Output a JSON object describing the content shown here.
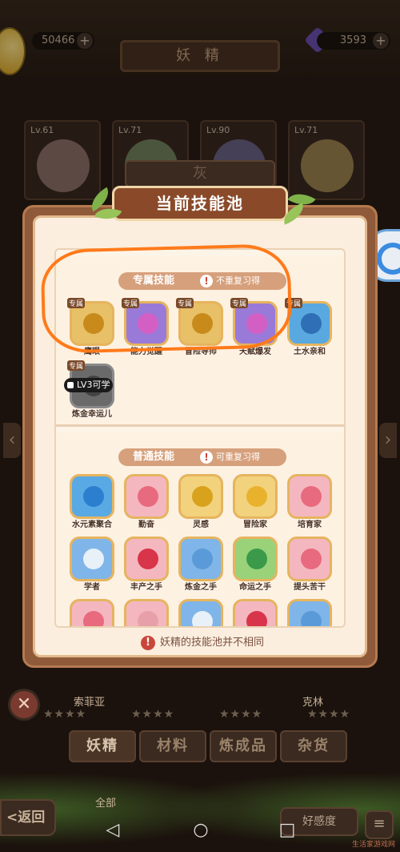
{
  "top_bar": {
    "title": "妖 精",
    "coins": "50466",
    "gems": "3593",
    "plus": "+"
  },
  "bg_cards": [
    {
      "level": "Lv.61"
    },
    {
      "level": "Lv.71"
    },
    {
      "level": "Lv.90"
    },
    {
      "level": "Lv.71"
    }
  ],
  "popup": {
    "back_tab": "灰",
    "title": "当前技能池",
    "exclusive_section": {
      "name": "专属技能",
      "warn": "!",
      "note": "不重复习得",
      "skills": [
        {
          "tag": "专属",
          "label": "鹰眼",
          "color": "#e7c067",
          "emblem": "#c98a1c"
        },
        {
          "tag": "专属",
          "label": "能力觉醒",
          "color": "#9a7ad8",
          "emblem": "#d35fc4"
        },
        {
          "tag": "专属",
          "label": "冒险导师",
          "color": "#e7c067",
          "emblem": "#c98a1c"
        },
        {
          "tag": "专属",
          "label": "天赋爆发",
          "color": "#9a7ad8",
          "emblem": "#d35fc4"
        },
        {
          "tag": "专属",
          "label": "土水亲和",
          "color": "#5aa8e0",
          "emblem": "#2f6fb5"
        },
        {
          "tag": "专属",
          "label": "炼金幸运儿",
          "color": "#6a6a6a",
          "emblem": "#444444",
          "locked": "LV3可学"
        }
      ]
    },
    "normal_section": {
      "name": "普通技能",
      "warn": "!",
      "note": "可重复习得",
      "skills": [
        {
          "label": "水元素聚合",
          "color": "#59a9e4",
          "emblem": "#2c7fcf"
        },
        {
          "label": "勤奋",
          "color": "#f4b7c0",
          "emblem": "#e86a7e"
        },
        {
          "label": "灵感",
          "color": "#f2d27c",
          "emblem": "#d9a21c"
        },
        {
          "label": "冒险家",
          "color": "#f2d27c",
          "emblem": "#e8b22c"
        },
        {
          "label": "培育家",
          "color": "#f4b7c0",
          "emblem": "#e86a7e"
        },
        {
          "label": "学者",
          "color": "#7fb5e8",
          "emblem": "#e8f0f8"
        },
        {
          "label": "丰产之手",
          "color": "#f4b7c0",
          "emblem": "#d8344a"
        },
        {
          "label": "炼金之手",
          "color": "#7fb5e8",
          "emblem": "#5a9ad8"
        },
        {
          "label": "命运之手",
          "color": "#9ad27a",
          "emblem": "#3a9a4a"
        },
        {
          "label": "提头苦干",
          "color": "#f4b7c0",
          "emblem": "#e86a7e"
        },
        {
          "label": "",
          "color": "#f4b7c0",
          "emblem": "#e86a7e"
        },
        {
          "label": "",
          "color": "#f4b7c0",
          "emblem": "#e8a0a8"
        },
        {
          "label": "",
          "color": "#7fb5e8",
          "emblem": "#e8f0f8"
        },
        {
          "label": "",
          "color": "#f4b7c0",
          "emblem": "#d8344a"
        },
        {
          "label": "",
          "color": "#7fb5e8",
          "emblem": "#5a9ad8"
        }
      ]
    },
    "footer_warn": "!",
    "footer_note": "妖精的技能池并不相同"
  },
  "bottom": {
    "close": "✕",
    "names": [
      "索菲亚",
      "克林"
    ],
    "stars": "★★★★",
    "tabs": [
      "妖精",
      "材料",
      "炼成品",
      "杂货"
    ],
    "back": "<返回",
    "all": "全部",
    "favor": "好感度",
    "menu": "≡"
  },
  "android_nav": {
    "back": "◁",
    "home": "○",
    "recent": "□"
  },
  "watermark": "生活家游戏网",
  "colors": {
    "accent_orange": "#ff7a1a",
    "popup_frame": "#8f5a3a",
    "popup_bg": "#fbeede"
  }
}
